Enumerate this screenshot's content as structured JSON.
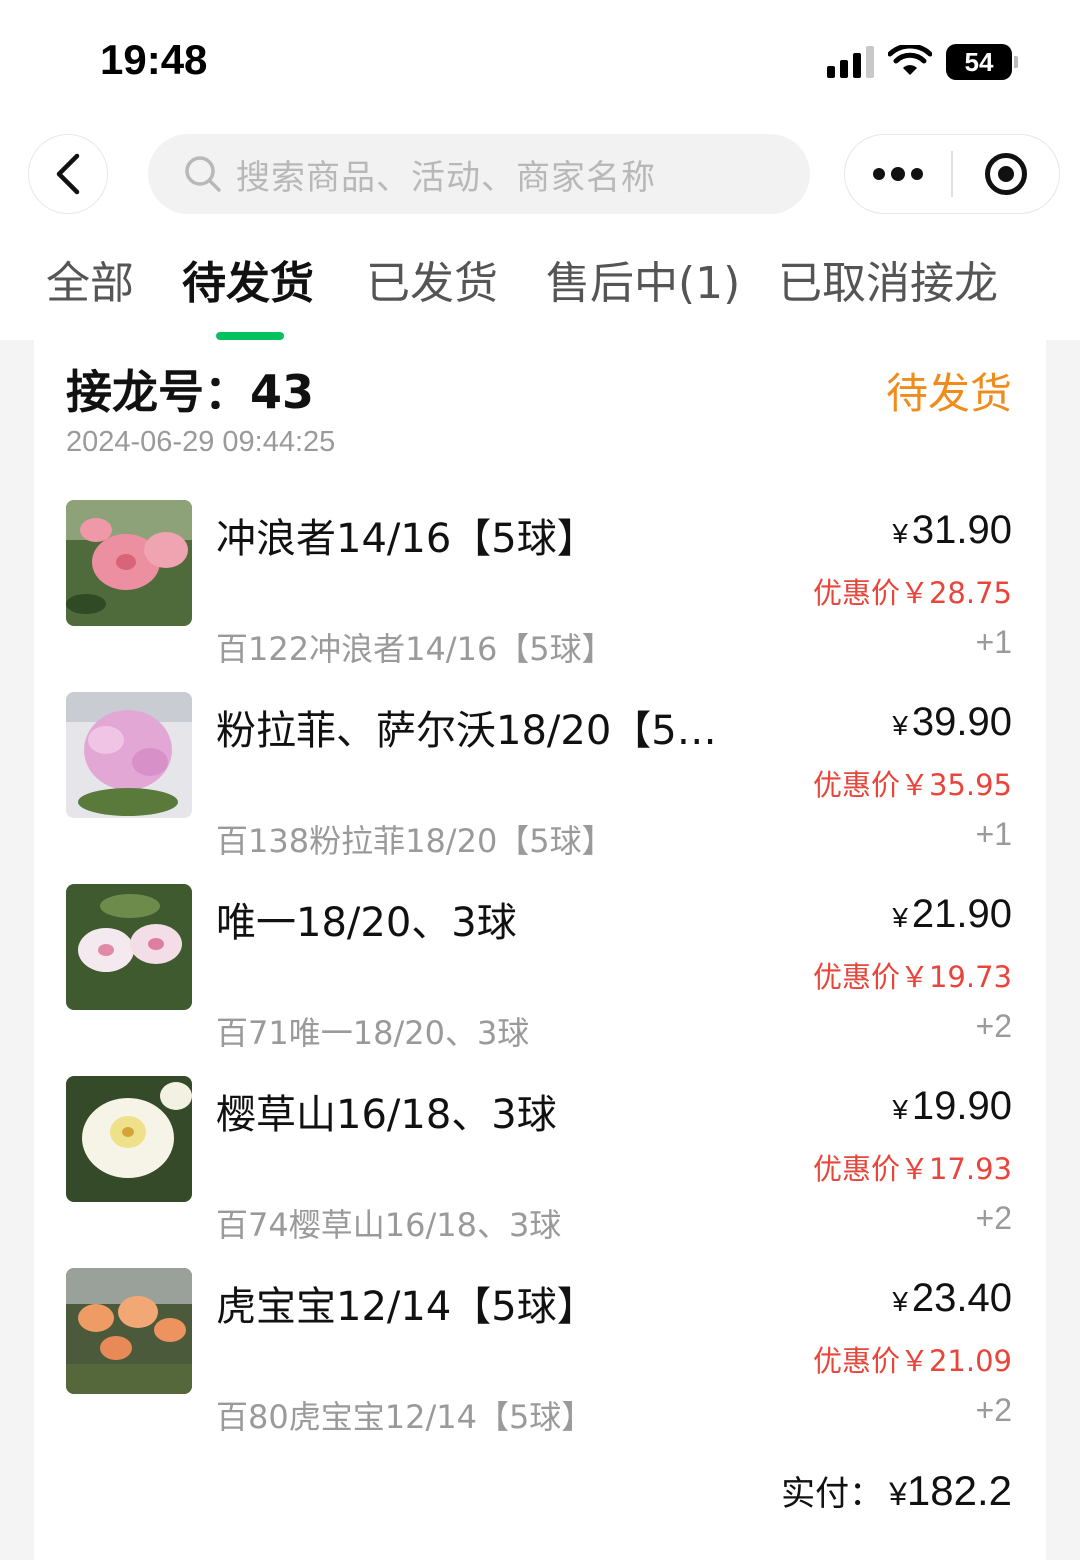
{
  "status_bar": {
    "time": "19:48",
    "battery": "54"
  },
  "nav": {
    "search_placeholder": "搜索商品、活动、商家名称"
  },
  "tabs": [
    {
      "label": "全部"
    },
    {
      "label": "待发货",
      "active": true
    },
    {
      "label": "已发货"
    },
    {
      "label": "售后中(1)"
    },
    {
      "label": "已取消接龙"
    }
  ],
  "order": {
    "number_label": "接龙号：43",
    "status": "待发货",
    "time": "2024-06-29 09:44:25",
    "items": [
      {
        "name": "冲浪者14/16【5球】",
        "price": "31.90",
        "discount": "优惠价￥28.75",
        "sku": "百122冲浪者14/16【5球】",
        "qty": "+1"
      },
      {
        "name": "粉拉菲、萨尔沃18/20【5…",
        "price": "39.90",
        "discount": "优惠价￥35.95",
        "sku": "百138粉拉菲18/20【5球】",
        "qty": "+1"
      },
      {
        "name": "唯一18/20、3球",
        "price": "21.90",
        "discount": "优惠价￥19.73",
        "sku": "百71唯一18/20、3球",
        "qty": "+2"
      },
      {
        "name": "樱草山16/18、3球",
        "price": "19.90",
        "discount": "优惠价￥17.93",
        "sku": "百74樱草山16/18、3球",
        "qty": "+2"
      },
      {
        "name": "虎宝宝12/14【5球】",
        "price": "23.40",
        "discount": "优惠价￥21.09",
        "sku": "百80虎宝宝12/14【5球】",
        "qty": "+2"
      }
    ],
    "total_label": "实付：",
    "total_value": "182.2",
    "currency": "¥"
  },
  "colors": {
    "accent_green": "#07c160",
    "status_orange": "#f08c1c",
    "discount_red": "#e8453c"
  }
}
